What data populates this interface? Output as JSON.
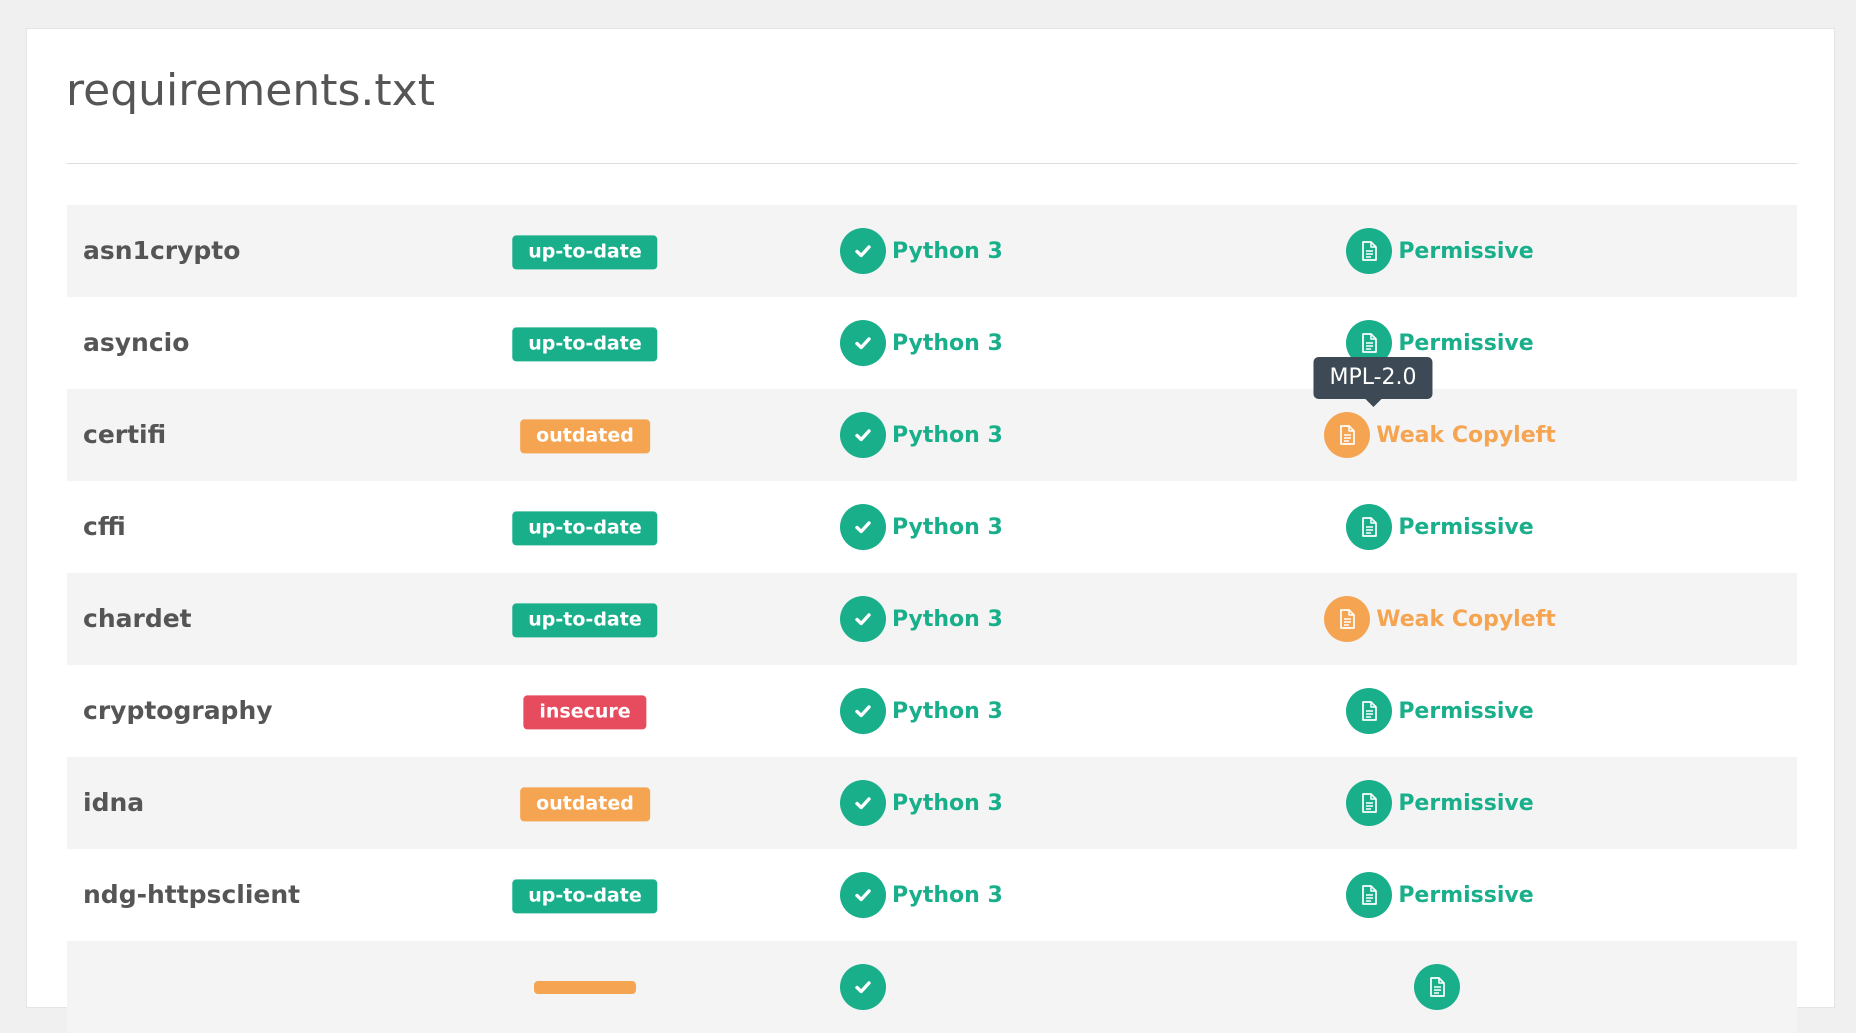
{
  "page": {
    "title": "requirements.txt"
  },
  "colors": {
    "green": "#1aaf8b",
    "orange": "#f5a552",
    "red": "#e74c5e",
    "text": "#555555",
    "row_alt": "#f4f4f4"
  },
  "icons": {
    "python": "check-icon",
    "license": "document-icon"
  },
  "tooltip": {
    "text": "MPL-2.0",
    "row": 2
  },
  "rows": [
    {
      "name": "asn1crypto",
      "status": "up-to-date",
      "status_color": "#1aaf8b",
      "python": "Python 3",
      "python_color": "#1aaf8b",
      "license": "Permissive",
      "license_color": "#1aaf8b"
    },
    {
      "name": "asyncio",
      "status": "up-to-date",
      "status_color": "#1aaf8b",
      "python": "Python 3",
      "python_color": "#1aaf8b",
      "license": "Permissive",
      "license_color": "#1aaf8b"
    },
    {
      "name": "certifi",
      "status": "outdated",
      "status_color": "#f5a552",
      "python": "Python 3",
      "python_color": "#1aaf8b",
      "license": "Weak Copyleft",
      "license_color": "#f5a552"
    },
    {
      "name": "cffi",
      "status": "up-to-date",
      "status_color": "#1aaf8b",
      "python": "Python 3",
      "python_color": "#1aaf8b",
      "license": "Permissive",
      "license_color": "#1aaf8b"
    },
    {
      "name": "chardet",
      "status": "up-to-date",
      "status_color": "#1aaf8b",
      "python": "Python 3",
      "python_color": "#1aaf8b",
      "license": "Weak Copyleft",
      "license_color": "#f5a552"
    },
    {
      "name": "cryptography",
      "status": "insecure",
      "status_color": "#e74c5e",
      "python": "Python 3",
      "python_color": "#1aaf8b",
      "license": "Permissive",
      "license_color": "#1aaf8b"
    },
    {
      "name": "idna",
      "status": "outdated",
      "status_color": "#f5a552",
      "python": "Python 3",
      "python_color": "#1aaf8b",
      "license": "Permissive",
      "license_color": "#1aaf8b"
    },
    {
      "name": "ndg-httpsclient",
      "status": "up-to-date",
      "status_color": "#1aaf8b",
      "python": "Python 3",
      "python_color": "#1aaf8b",
      "license": "Permissive",
      "license_color": "#1aaf8b"
    },
    {
      "name": "",
      "status": "",
      "status_color": "#f5a552",
      "python": "",
      "python_color": "#1aaf8b",
      "license": "",
      "license_color": "#1aaf8b"
    }
  ]
}
